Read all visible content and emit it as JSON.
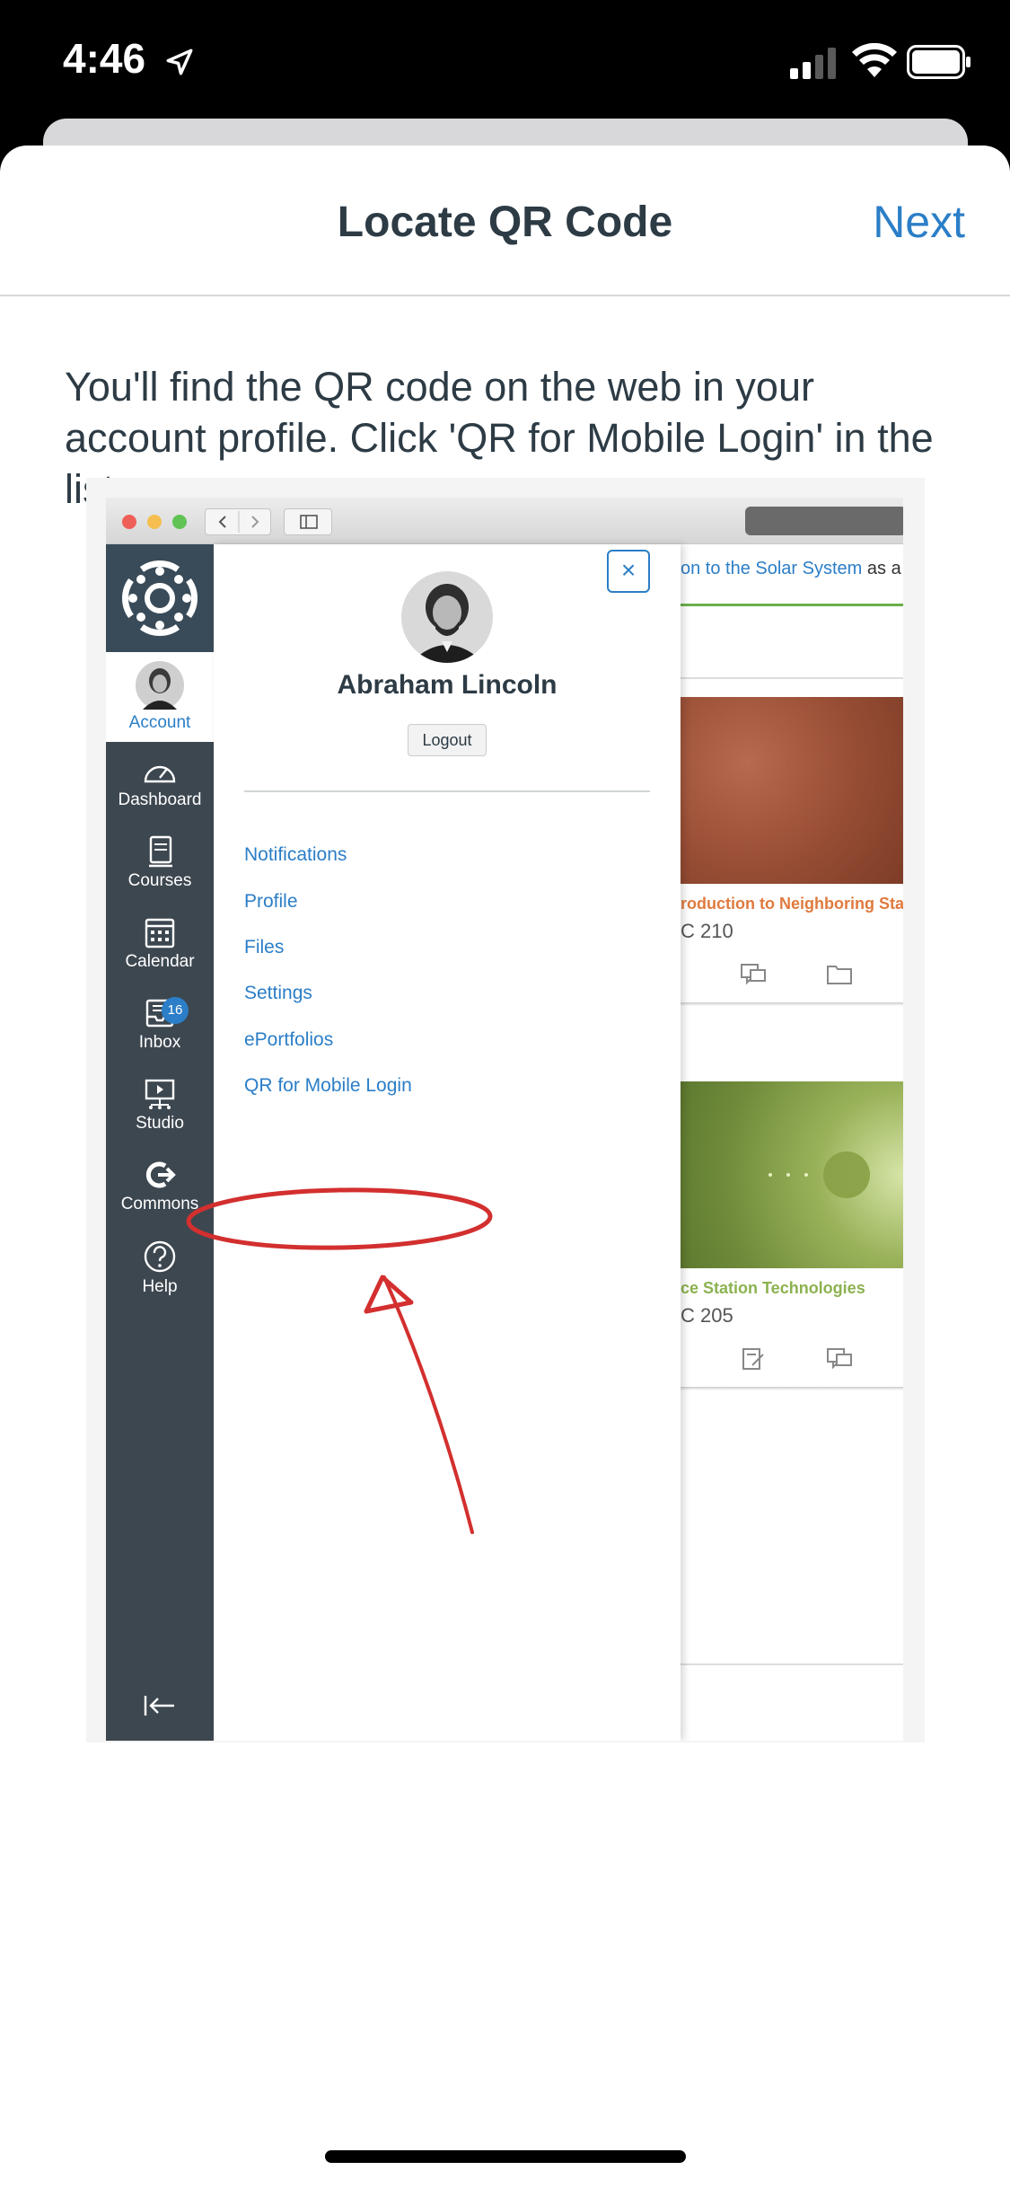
{
  "status_bar": {
    "time": "4:46"
  },
  "nav": {
    "title": "Locate QR Code",
    "next_label": "Next"
  },
  "instruction": "You'll find the QR code on the web in your account profile. Click 'QR for Mobile Login' in the list.",
  "illustration": {
    "sidebar": {
      "account": "Account",
      "dashboard": "Dashboard",
      "courses": "Courses",
      "calendar": "Calendar",
      "inbox": "Inbox",
      "inbox_badge": "16",
      "studio": "Studio",
      "commons": "Commons",
      "help": "Help"
    },
    "tray": {
      "close": "×",
      "name": "Abraham Lincoln",
      "logout": "Logout",
      "links": [
        "Notifications",
        "Profile",
        "Files",
        "Settings",
        "ePortfolios",
        "QR for Mobile Login"
      ]
    },
    "background": {
      "link_text": "on to the Solar System",
      "link_suffix": " as a",
      "card1_title": "roduction to Neighboring Sta",
      "card1_code": "C 210",
      "card2_title": "ce Station Technologies",
      "card2_code": "C 205"
    },
    "colors": {
      "accent": "#2b7ec7",
      "sidebar": "#3d4750",
      "highlight": "#d32f2f"
    }
  }
}
